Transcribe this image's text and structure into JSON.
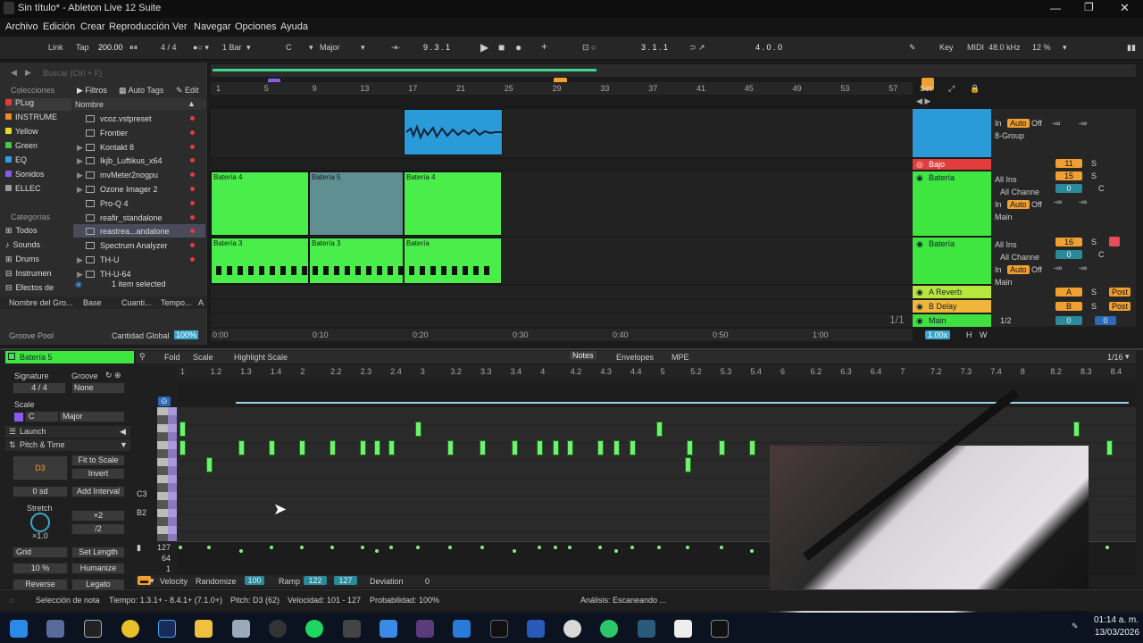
{
  "window": {
    "title": "Sin título* - Ableton Live 12 Suite"
  },
  "menu": [
    "Archivo",
    "Edición",
    "Crear",
    "Reproducción",
    "Ver",
    "Navegar",
    "Opciones",
    "Ayuda"
  ],
  "control_bar": {
    "link": "Link",
    "tap": "Tap",
    "tempo": "200.00",
    "signature": "4 / 4",
    "quantize": "1 Bar",
    "key": "C",
    "scale": "Major",
    "position": "9 . 3 . 1",
    "loop_start": "3 . 1 . 1",
    "loop_length": "4 . 0 . 0",
    "key_btn": "Key",
    "midi": "MIDI",
    "sample_rate": "48.0 kHz",
    "cpu": "12 %"
  },
  "browser": {
    "search_placeholder": "Buscar (Ctrl + F)",
    "collections_header": "Colecciones",
    "filters": "Filtros",
    "auto_tags": "Auto Tags",
    "edit": "Edit",
    "name_header": "Nombre",
    "collections": [
      {
        "label": "PLug",
        "color": "#e8383a"
      },
      {
        "label": "INSTRUME",
        "color": "#f08a2a"
      },
      {
        "label": "Yellow",
        "color": "#e7d72c"
      },
      {
        "label": "Green",
        "color": "#49c64a"
      },
      {
        "label": "EQ",
        "color": "#2aa3e6"
      },
      {
        "label": "Sonidos",
        "color": "#8a5ae8"
      },
      {
        "label": "ELLEC",
        "color": "#9a9a9a"
      }
    ],
    "categories_header": "Categorías",
    "categories": [
      "Todos",
      "Sounds",
      "Drums",
      "Instrumen",
      "Efectos de"
    ],
    "items": [
      "vcoz.vstpreset",
      "Frontier",
      "Kontakt 8",
      "Ikjb_Luftikus_x64",
      "mvMeter2nogpu",
      "Ozone Imager 2",
      "Pro-Q 4",
      "reafir_standalone",
      "reastrea...andalone",
      "Spectrum Analyzer",
      "TH-U",
      "TH-U-64"
    ],
    "selected_info": "1 item selected",
    "groove_cols": [
      "Nombre del Gro...",
      "Base",
      "Cuanti...",
      "Tempo...",
      "A"
    ],
    "groove_pool": "Groove Pool",
    "cantidad_global": "Cantidad Global",
    "cantidad_value": "100%"
  },
  "arrangement": {
    "bar_ruler": [
      "1",
      "5",
      "9",
      "13",
      "17",
      "21",
      "25",
      "29",
      "33",
      "37",
      "41",
      "45",
      "49",
      "53",
      "57"
    ],
    "set_label": "Set",
    "time_ruler": [
      "0:00",
      "0:10",
      "0:20",
      "0:30",
      "0:40",
      "0:50",
      "1:00"
    ],
    "clips_track2": [
      "Batería 4",
      "Batería 5",
      "Batería 4"
    ],
    "clips_track3": [
      "Batería 3",
      "Batería 3",
      "Batería"
    ],
    "ratio": "1/1",
    "zoom": "1.00x"
  },
  "mixer": {
    "tracks": [
      {
        "name": "Bajo",
        "num": "11",
        "color": "#e23c3c"
      },
      {
        "name": "Batería",
        "num": "15",
        "color": "#3fe63f"
      },
      {
        "name": "Batería",
        "num": "16",
        "color": "#3fe63f"
      }
    ],
    "returns": [
      {
        "name": "A Reverb",
        "letter": "A",
        "color": "#b8e63c"
      },
      {
        "name": "B Delay",
        "letter": "B",
        "color": "#f0b63a"
      },
      {
        "name": "Main",
        "letter": "0",
        "color": "#40e040"
      }
    ],
    "in_label": "In",
    "auto_label": "Auto",
    "off_label": "Off",
    "group": "8-Group",
    "all_ins": "All Ins",
    "all_channels": "All Channe",
    "main_out": "Main",
    "minus_inf": "-∞",
    "center": "C",
    "post": "Post",
    "half": "1/2",
    "s_label": "S"
  },
  "clip_detail": {
    "clip_name": "Batería 5",
    "signature_label": "Signature",
    "groove_label": "Groove",
    "sig_num": "4",
    "sig_den": "4",
    "groove_value": "None",
    "scale_label": "Scale",
    "scale_key": "C",
    "scale_mode": "Major",
    "launch": "Launch",
    "pitch_time": "Pitch & Time",
    "pitch_note": "D3",
    "fit_to_scale": "Fit to Scale",
    "invert": "Invert",
    "transpose": "0 sd",
    "add_interval": "Add Interval",
    "stretch": "Stretch",
    "x2": "×2",
    "div2": "/2",
    "stretch_val": "×1.0",
    "grid": "Grid",
    "set_length": "Set Length",
    "percent": "10 %",
    "humanize": "Humanize",
    "reverse": "Reverse",
    "legato": "Legato",
    "fold": "Fold",
    "scale_btn": "Scale",
    "highlight_scale": "Highlight Scale",
    "tabs": [
      "Notes",
      "Envelopes",
      "MPE"
    ],
    "grid_size": "1/16",
    "ruler": [
      "1",
      "1.2",
      "1.3",
      "1.4",
      "2",
      "2.2",
      "2.3",
      "2.4",
      "3",
      "3.2",
      "3.3",
      "3.4",
      "4",
      "4.2",
      "4.3",
      "4.4",
      "5",
      "5.2",
      "5.3",
      "5.4",
      "6",
      "6.2",
      "6.3",
      "6.4",
      "7",
      "7.2",
      "7.3",
      "7.4",
      "8",
      "8.2",
      "8.3",
      "8.4"
    ],
    "key_c3": "C3",
    "key_b2": "B2",
    "vel_labels": [
      "127",
      "64",
      "1"
    ],
    "velocity": "Velocity",
    "randomize": "Randomize",
    "rand_val": "100",
    "ramp": "Ramp",
    "ramp_a": "122",
    "ramp_b": "127",
    "deviation": "Deviation",
    "deviation_val": "0"
  },
  "status": {
    "selection": "Selección de nota",
    "time": "Tiempo: 1.3.1+ - 8.4.1+ (7.1.0+)",
    "pitch": "Pitch: D3 (62)",
    "velocity": "Velocidad: 101 - 127",
    "probability": "Probabilidad: 100%",
    "analysis": "Análisis: Escaneando ..."
  },
  "taskbar": {
    "time": "01:14 a. m.",
    "date": "13/03/2026"
  }
}
